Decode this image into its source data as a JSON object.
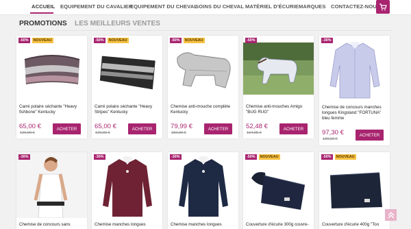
{
  "nav": {
    "items": [
      "ACCUEIL",
      "EQUIPEMENT DU CAVALIER",
      "EQUIPEMENT DU CHEVAL",
      "SOINS DU CHEVAL",
      "MATÉRIEL D'ÉCURIE",
      "MARQUES",
      "CONTACTEZ-NOUS"
    ],
    "active": "ACCUEIL",
    "cart_icon": "cart-icon"
  },
  "tabs": [
    "PROMOTIONS",
    "LES MEILLEURS VENTES"
  ],
  "colors": {
    "accent": "#a8246f",
    "badge_new": "#f6c142",
    "page_bg": "#f1f1f1"
  },
  "products": [
    {
      "discount": "-50%",
      "new": "NOUVEAU",
      "name": "Carré polaire séchante \"Heavy fishbone\" Kentucky",
      "price": "65,00 €",
      "old_price": "129,99 €",
      "button": "ACHETER",
      "image": "pink-grey-saddle-pad"
    },
    {
      "discount": "-50%",
      "new": "NOUVEAU",
      "name": "Carré polaire séchante \"Heavy Stripes\" Kentucky",
      "price": "65,00 €",
      "old_price": "129,99 €",
      "button": "ACHETER",
      "image": "black-striped-saddle-pad"
    },
    {
      "discount": "-50%",
      "new": "NOUVEAU",
      "name": "Chemise anti-mouche complète Kentucky",
      "price": "79,99 €",
      "old_price": "159,99 €",
      "button": "ACHETER",
      "image": "grey-fly-sheet"
    },
    {
      "discount": "-50%",
      "new": "",
      "name": "Chemise anti-mouches Amigo \"BUG RUG\"",
      "price": "52,48 €",
      "old_price": "104,95 €",
      "button": "ACHETER",
      "image": "horse-in-field-photo"
    },
    {
      "discount": "-30%",
      "new": "",
      "name": "Chemise de concours manches longues Kingsland \"FORTUNA\" bleu femme",
      "price": "97,30 €",
      "old_price": "139,00 €",
      "button": "ACHETER",
      "image": "lavender-show-shirt"
    },
    {
      "discount": "-30%",
      "new": "",
      "name": "Chemise de concours sans",
      "image": "woman-sleeveless-shirt-photo"
    },
    {
      "discount": "-30%",
      "new": "",
      "name": "Chemise manches longues",
      "image": "burgundy-show-shirt"
    },
    {
      "discount": "-30%",
      "new": "",
      "name": "Chemise manches longues",
      "image": "navy-show-shirt"
    },
    {
      "discount": "-50%",
      "new": "NOUVEAU",
      "name": "Couverture d'écurie 300g couvre-",
      "image": "navy-stable-rug-neck"
    },
    {
      "discount": "-50%",
      "new": "NOUVEAU",
      "name": "Couverture d'écurie 400g \"Too",
      "image": "navy-stable-rug"
    }
  ],
  "scroll_top_icon": "double-chevron-up-icon"
}
